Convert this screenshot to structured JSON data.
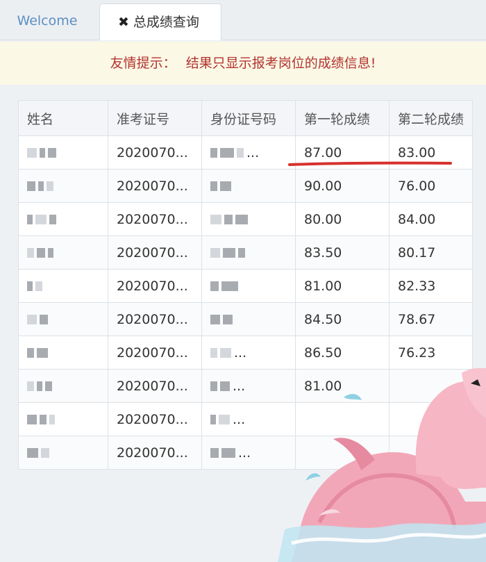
{
  "tabs": {
    "welcome": "Welcome",
    "active": "总成绩查询",
    "close_glyph": "✖"
  },
  "notice": {
    "prefix": "友情提示：",
    "text": "结果只显示报考岗位的成绩信息!"
  },
  "table": {
    "headers": [
      "姓名",
      "准考证号",
      "身份证号码",
      "第一轮成绩",
      "第二轮成绩"
    ],
    "rows": [
      {
        "name": "",
        "exam_no": "2020070...",
        "id_no": "...",
        "round1": "87.00",
        "round2": "83.00"
      },
      {
        "name": "",
        "exam_no": "2020070...",
        "id_no": "",
        "round1": "90.00",
        "round2": "76.00"
      },
      {
        "name": "",
        "exam_no": "2020070...",
        "id_no": "",
        "round1": "80.00",
        "round2": "84.00"
      },
      {
        "name": "",
        "exam_no": "2020070...",
        "id_no": "",
        "round1": "83.50",
        "round2": "80.17"
      },
      {
        "name": "",
        "exam_no": "2020070...",
        "id_no": "",
        "round1": "81.00",
        "round2": "82.33"
      },
      {
        "name": "",
        "exam_no": "2020070...",
        "id_no": "",
        "round1": "84.50",
        "round2": "78.67"
      },
      {
        "name": "",
        "exam_no": "2020070...",
        "id_no": "...",
        "round1": "86.50",
        "round2": "76.23"
      },
      {
        "name": "",
        "exam_no": "2020070...",
        "id_no": "...",
        "round1": "81.00",
        "round2": ""
      },
      {
        "name": "",
        "exam_no": "2020070...",
        "id_no": "...",
        "round1": "",
        "round2": ""
      },
      {
        "name": "",
        "exam_no": "2020070...",
        "id_no": "...",
        "round1": "",
        "round2": ""
      }
    ]
  },
  "colors": {
    "notice_text": "#b3332e",
    "underline": "#d6312d",
    "welcome_tab": "#5b8fc4"
  },
  "icons": [
    "close-icon",
    "flamingo-sticker"
  ]
}
